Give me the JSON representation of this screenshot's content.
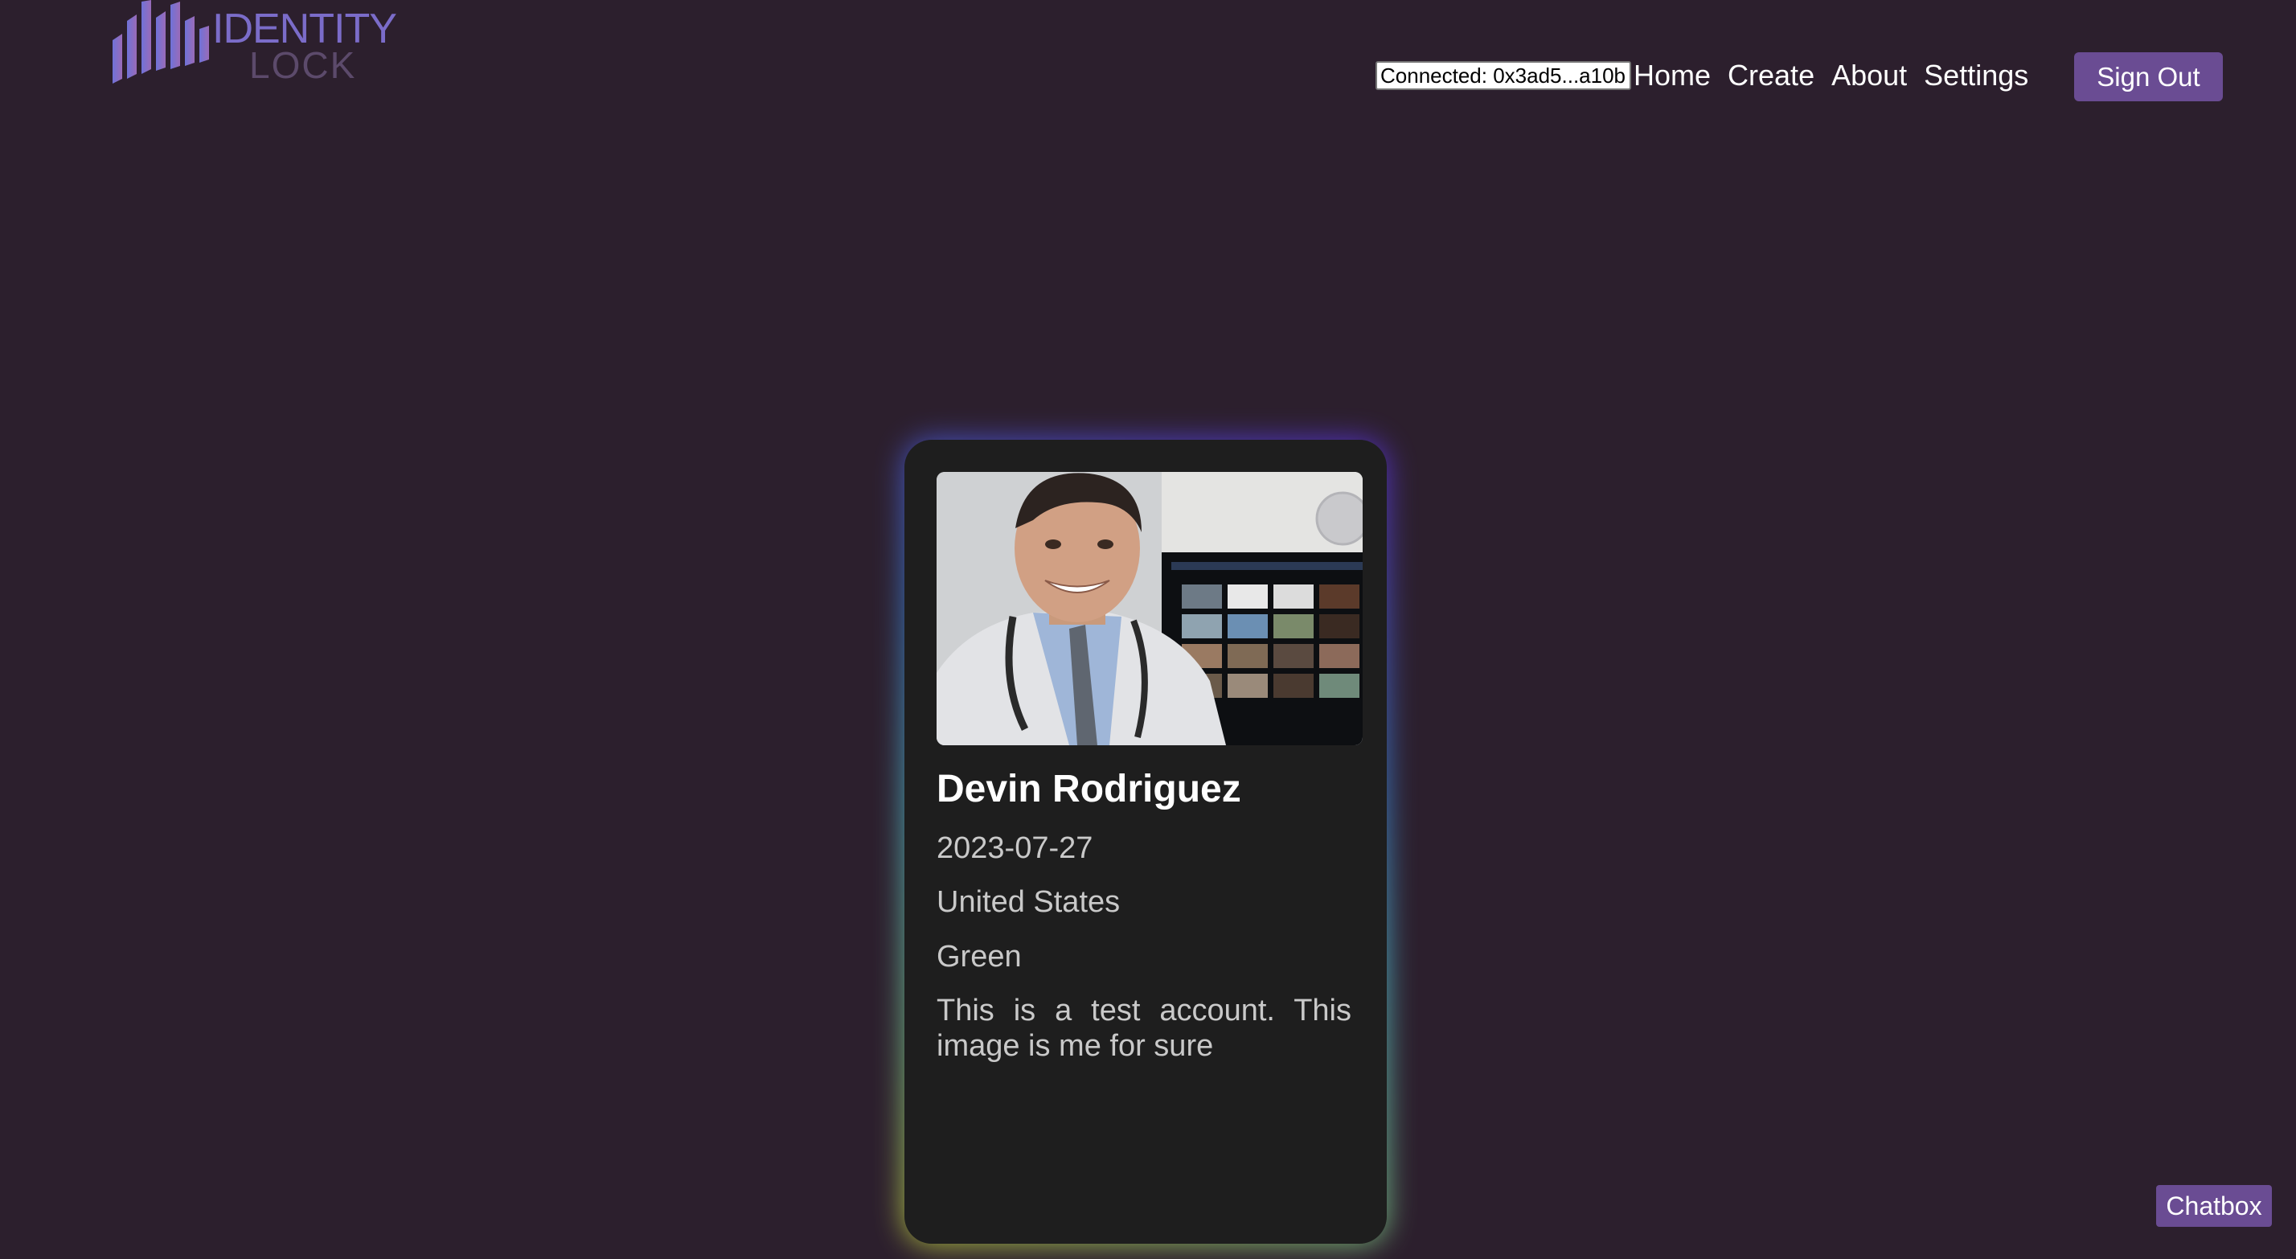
{
  "logo": {
    "line1": "IDENTITY",
    "line2": "LOCK",
    "colors": {
      "primary": "#7b6cc9",
      "secondary": "#5c4a6b"
    }
  },
  "header": {
    "wallet_status": "Connected: 0x3ad5...a10b",
    "nav": [
      {
        "label": "Home"
      },
      {
        "label": "Create"
      },
      {
        "label": "About"
      },
      {
        "label": "Settings"
      }
    ],
    "sign_out_label": "Sign Out"
  },
  "card": {
    "name": "Devin Rodriguez",
    "date": "2023-07-27",
    "country": "United States",
    "color": "Green",
    "description": "This is a test account. This image is me for sure",
    "photo_alt": "Profile photo of a smiling doctor with stethoscope"
  },
  "chatbox_label": "Chatbox",
  "colors": {
    "background": "#2c1f2d",
    "card": "#1e1e1e",
    "accent": "#6a4c93"
  }
}
